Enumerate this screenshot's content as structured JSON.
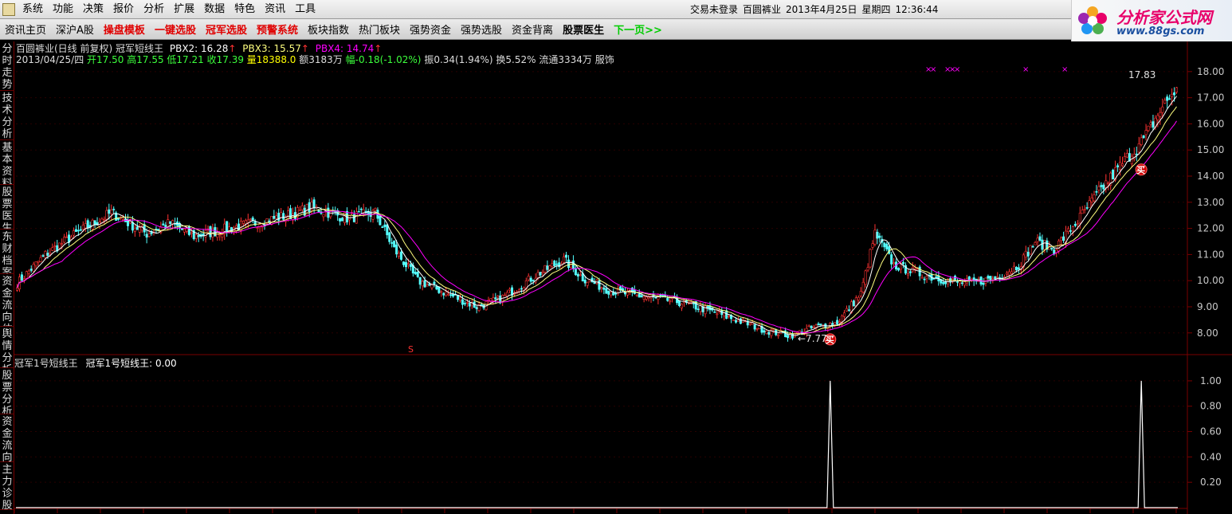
{
  "menubar": {
    "items": [
      "系统",
      "功能",
      "决策",
      "报价",
      "分析",
      "扩展",
      "数据",
      "特色",
      "资讯",
      "工具"
    ],
    "status": [
      "交易未登录",
      "百圆裤业",
      "2013年4月25日",
      "星期四",
      "12:36:44"
    ]
  },
  "logo": {
    "title": "分析家公式网",
    "url": "www.88gs.com"
  },
  "toolbar": [
    {
      "label": "资讯主页",
      "style": "normal"
    },
    {
      "label": "深沪A股",
      "style": "normal"
    },
    {
      "label": "操盘模板",
      "style": "red"
    },
    {
      "label": "一键选股",
      "style": "red"
    },
    {
      "label": "冠军选股",
      "style": "red"
    },
    {
      "label": "预警系统",
      "style": "red"
    },
    {
      "label": "板块指数",
      "style": "normal"
    },
    {
      "label": "热门板块",
      "style": "normal"
    },
    {
      "label": "强势资金",
      "style": "normal"
    },
    {
      "label": "强势选股",
      "style": "normal"
    },
    {
      "label": "资金背离",
      "style": "normal"
    },
    {
      "label": "股票医生",
      "style": "bold"
    },
    {
      "label": "下一页>>",
      "style": "green"
    }
  ],
  "sidetabs": [
    "分时走势",
    "技术分析",
    "基本资料",
    "股票医生",
    "东财档案",
    "资金流向估值",
    "舆情分析",
    "股票分析",
    "资金流向",
    "主力诊股"
  ],
  "main_panel": {
    "line1": {
      "stock": "百圆裤业(日线 前复权)",
      "indicator": "冠军短线王",
      "pbx2": "PBX2: 16.28",
      "pbx3": "PBX3: 15.57",
      "pbx4": "PBX4: 14.74"
    },
    "line2": {
      "date": "2013/04/25/四",
      "open": "开17.50",
      "high": "高17.55",
      "low": "低17.21",
      "close": "收17.39",
      "vol": "量18388.0",
      "amount": "额3183万",
      "change": "幅-0.18(-1.02%)",
      "amp": "振0.34(1.94%)",
      "turnover": "换5.52%",
      "float": "流通3334万",
      "industry": "服饰"
    },
    "annotations": {
      "high_label": "17.83",
      "low_label": "←7.77",
      "buy_label": "买",
      "s_label": "S"
    },
    "colors": {
      "up": "#ff3232",
      "down": "#54ffff",
      "pbx2": "#ffffff",
      "pbx3": "#ffff80",
      "pbx4": "#ff00ff",
      "grid": "#7a0000"
    }
  },
  "sub_panel": {
    "title": "冠军1号短线王",
    "value_text": "冠军1号短线王: 0.00"
  },
  "chart_data": [
    {
      "type": "candlestick",
      "title": "百圆裤业(日线 前复权)",
      "yticks": [
        8.0,
        9.0,
        10.0,
        11.0,
        12.0,
        13.0,
        14.0,
        15.0,
        16.0,
        17.0,
        18.0
      ],
      "ylim": [
        7.2,
        18.3
      ],
      "series_anchor_closes": [
        [
          0,
          9.9
        ],
        [
          12,
          11.0
        ],
        [
          25,
          11.8
        ],
        [
          40,
          12.6
        ],
        [
          55,
          11.8
        ],
        [
          65,
          12.2
        ],
        [
          75,
          11.7
        ],
        [
          90,
          12.0
        ],
        [
          100,
          12.2
        ],
        [
          115,
          12.5
        ],
        [
          125,
          12.8
        ],
        [
          140,
          12.4
        ],
        [
          152,
          12.6
        ],
        [
          160,
          11.2
        ],
        [
          170,
          10.0
        ],
        [
          185,
          9.4
        ],
        [
          195,
          9.0
        ],
        [
          205,
          9.3
        ],
        [
          220,
          10.2
        ],
        [
          232,
          10.8
        ],
        [
          240,
          10.1
        ],
        [
          252,
          9.6
        ],
        [
          265,
          9.4
        ],
        [
          280,
          9.2
        ],
        [
          292,
          8.9
        ],
        [
          305,
          8.5
        ],
        [
          318,
          8.1
        ],
        [
          328,
          7.9
        ],
        [
          338,
          8.2
        ],
        [
          348,
          8.4
        ],
        [
          358,
          9.5
        ],
        [
          364,
          11.8
        ],
        [
          372,
          10.6
        ],
        [
          385,
          10.2
        ],
        [
          395,
          10.0
        ],
        [
          405,
          9.9
        ],
        [
          415,
          10.1
        ],
        [
          425,
          10.6
        ],
        [
          432,
          11.5
        ],
        [
          440,
          11.2
        ],
        [
          450,
          12.3
        ],
        [
          460,
          13.5
        ],
        [
          470,
          14.6
        ],
        [
          478,
          15.4
        ],
        [
          485,
          16.5
        ],
        [
          492,
          17.39
        ]
      ],
      "buy_signals": [
        [
          345,
          8.3
        ],
        [
          477,
          14.8
        ]
      ]
    },
    {
      "type": "line",
      "title": "冠军1号短线王",
      "yticks": [
        0.2,
        0.4,
        0.6,
        0.8,
        1.0
      ],
      "ylim": [
        0,
        1.1
      ],
      "spikes_at_bar": [
        345,
        477
      ],
      "values_description_note": ""
    }
  ]
}
